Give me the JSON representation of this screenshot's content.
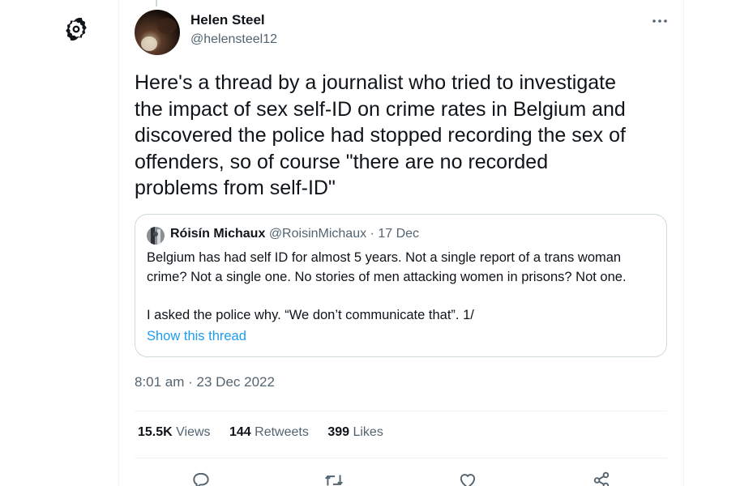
{
  "author": {
    "name": "Helen Steel",
    "handle": "@helensteel12"
  },
  "tweet": {
    "text": "Here's a thread by a journalist who tried to investigate\nthe impact of sex self-ID on crime rates in Belgium and\ndiscovered the police had stopped recording the sex of\noffenders, so of course \"there are no recorded\nproblems from self-ID\"",
    "timestamp": "8:01 am · 23 Dec 2022"
  },
  "quote": {
    "name": "Róisín Michaux",
    "handle": "@RoisinMichaux",
    "separator": "·",
    "date": "17 Dec",
    "text": "Belgium has had self ID for almost 5 years. Not a single report of a trans woman\ncrime? Not a single one. No stories of men attacking women in prisons? Not one.\n\nI asked the police why. “We don’t communicate that”. 1/",
    "show_thread": "Show this thread"
  },
  "stats": {
    "views_count": "15.5K",
    "views_label": "Views",
    "retweets_count": "144",
    "retweets_label": "Retweets",
    "likes_count": "399",
    "likes_label": "Likes"
  },
  "icons": {
    "settings": "gear-icon",
    "more": "more-horizontal-icon",
    "reply": "reply-icon",
    "retweet": "retweet-icon",
    "like": "heart-icon",
    "share": "share-icon"
  },
  "colors": {
    "text": "#0f1419",
    "secondary": "#536471",
    "link": "#1d9bf0",
    "border": "#cfd9de"
  }
}
